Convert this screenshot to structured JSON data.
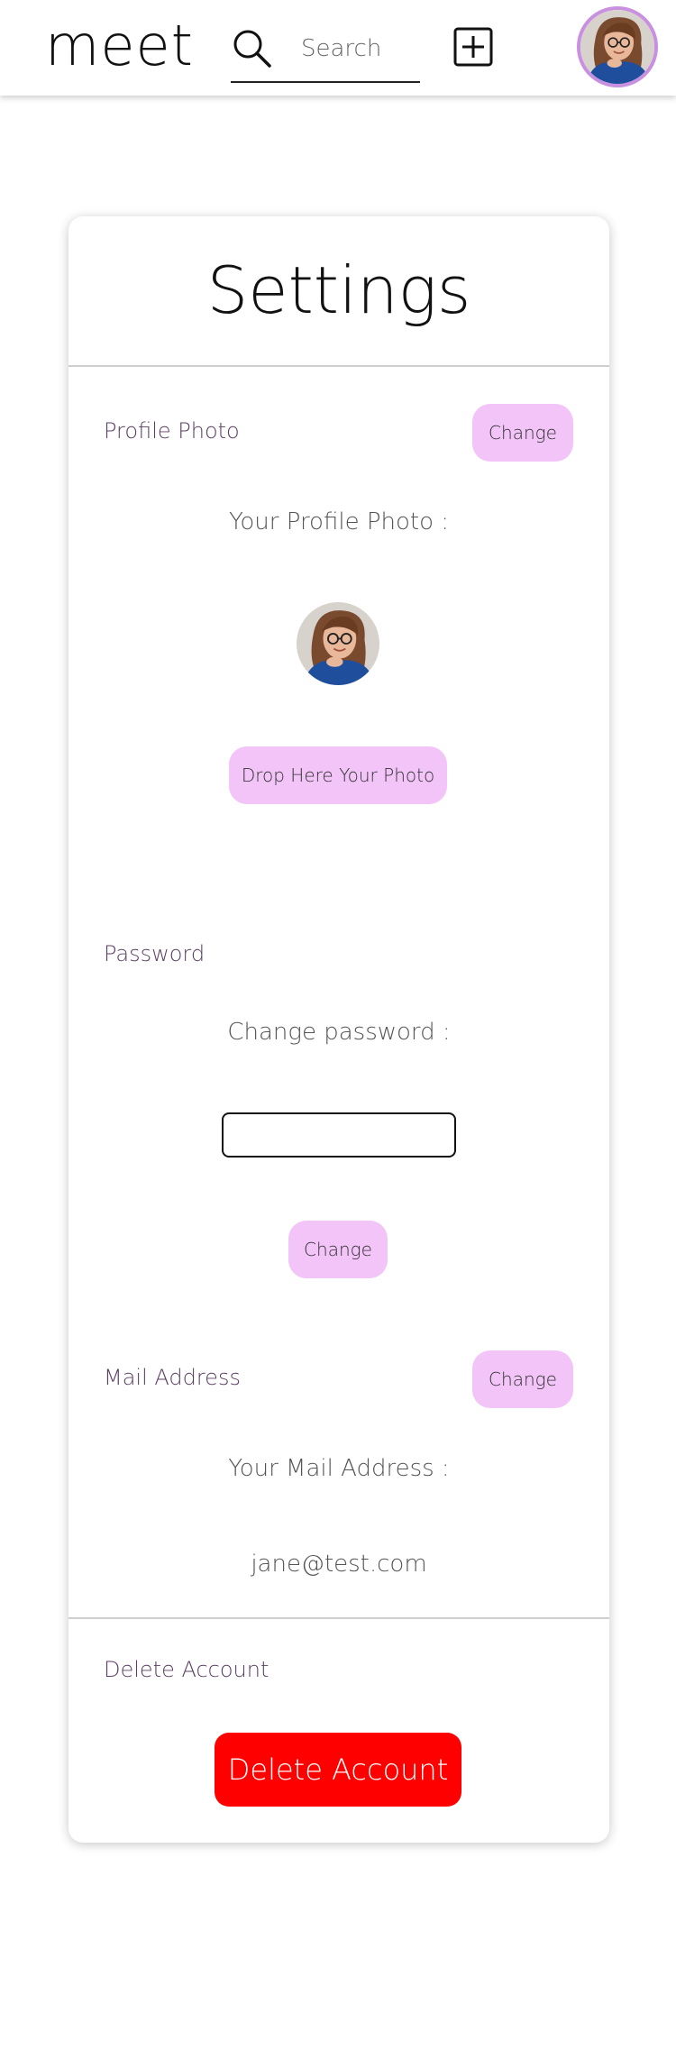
{
  "header": {
    "logo": "meet",
    "search_placeholder": "Search",
    "icons": {
      "search": "search-icon",
      "add": "plus-square-icon",
      "avatar": "avatar"
    }
  },
  "settings": {
    "title": "Settings",
    "profile_photo": {
      "label": "Profile Photo",
      "change_label": "Change",
      "caption": "Your Profile Photo :",
      "drop_label": "Drop Here Your Photo"
    },
    "password": {
      "label": "Password",
      "caption": "Change password :",
      "input_value": "",
      "change_label": "Change"
    },
    "mail": {
      "label": "Mail Address",
      "change_label": "Change",
      "caption": "Your Mail Address :",
      "value": "jane@test.com"
    },
    "delete": {
      "label": "Delete Account",
      "button_label": "Delete Account"
    }
  },
  "colors": {
    "accent_pill": "#f2c4f8",
    "delete": "#ff0000",
    "avatar_ring": "#c98fe0",
    "label_text": "#5b3e63"
  }
}
